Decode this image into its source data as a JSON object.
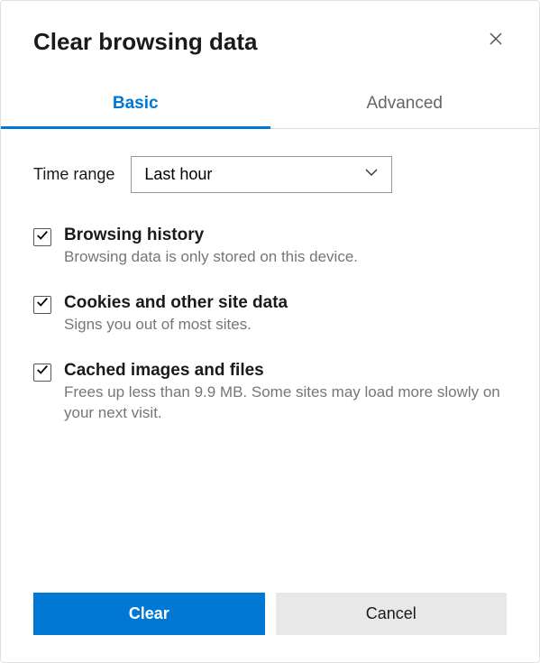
{
  "title": "Clear browsing data",
  "tabs": {
    "basic": "Basic",
    "advanced": "Advanced"
  },
  "timeRange": {
    "label": "Time range",
    "value": "Last hour"
  },
  "options": [
    {
      "title": "Browsing history",
      "desc": "Browsing data is only stored on this device.",
      "checked": true
    },
    {
      "title": "Cookies and other site data",
      "desc": "Signs you out of most sites.",
      "checked": true
    },
    {
      "title": "Cached images and files",
      "desc": "Frees up less than 9.9 MB. Some sites may load more slowly on your next visit.",
      "checked": true
    }
  ],
  "buttons": {
    "clear": "Clear",
    "cancel": "Cancel"
  }
}
